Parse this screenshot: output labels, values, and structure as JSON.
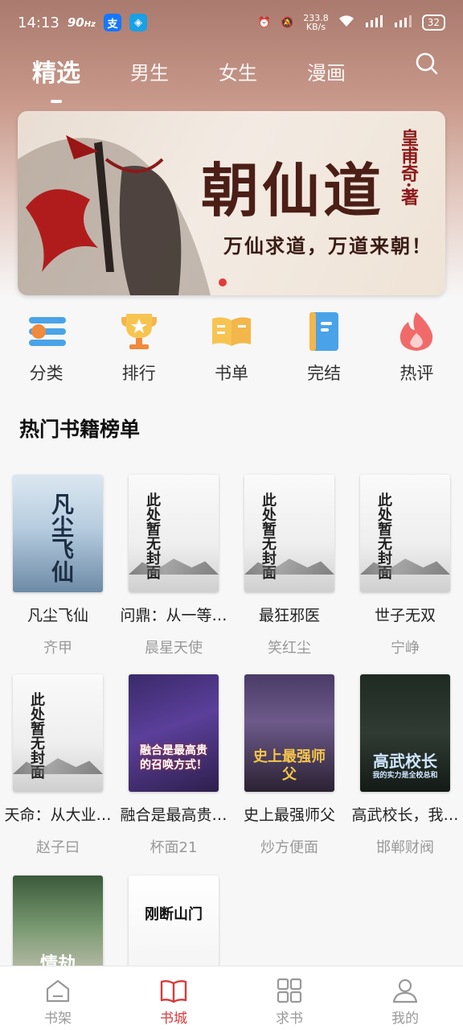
{
  "status": {
    "time": "14:13",
    "hz": "90",
    "hz_unit": "Hz",
    "speed": "233.8",
    "speed_unit": "KB/s",
    "battery": "32"
  },
  "nav": {
    "tabs": [
      {
        "label": "精选",
        "active": true
      },
      {
        "label": "男生",
        "active": false
      },
      {
        "label": "女生",
        "active": false
      },
      {
        "label": "漫画",
        "active": false
      }
    ]
  },
  "banner": {
    "title": "朝仙道",
    "author": "皇甫奇·著",
    "slogan": "万仙求道，万道来朝！"
  },
  "quick_nav": [
    {
      "label": "分类",
      "icon": "category-icon"
    },
    {
      "label": "排行",
      "icon": "trophy-icon"
    },
    {
      "label": "书单",
      "icon": "book-open-icon"
    },
    {
      "label": "完结",
      "icon": "notebook-icon"
    },
    {
      "label": "热评",
      "icon": "flame-icon"
    }
  ],
  "section_title": "热门书籍榜单",
  "books": [
    {
      "title": "凡尘飞仙",
      "author": "齐甲",
      "cover": "fanchen",
      "cover_text": "凡尘飞仙"
    },
    {
      "title": "问鼎：从一等…",
      "author": "晨星天使",
      "cover": "default"
    },
    {
      "title": "最狂邪医",
      "author": "笑红尘",
      "cover": "default"
    },
    {
      "title": "世子无双",
      "author": "宁峥",
      "cover": "default"
    },
    {
      "title": "天命：从大业…",
      "author": "赵子曰",
      "cover": "default"
    },
    {
      "title": "融合是最高贵…",
      "author": "杯面21",
      "cover": "ronghe",
      "cover_text": "融合是最高贵的召唤方式！"
    },
    {
      "title": "史上最强师父",
      "author": "炒方便面",
      "cover": "shifu",
      "cover_text": "史上最强师父"
    },
    {
      "title": "高武校长，我…",
      "author": "邯郸财阀",
      "cover": "gaowu",
      "cover_text": "高武校长",
      "cover_sub": "我的实力是全校总和"
    },
    {
      "title": "",
      "author": "",
      "cover": "qingjie",
      "cover_text": "情劫"
    },
    {
      "title": "",
      "author": "",
      "cover": "xiaomen",
      "cover_text": "刚断山门"
    }
  ],
  "default_cover_text": "此处暂无封面",
  "tabbar": [
    {
      "label": "书架",
      "icon": "bookshelf-icon",
      "active": false
    },
    {
      "label": "书城",
      "icon": "bookstore-icon",
      "active": true
    },
    {
      "label": "求书",
      "icon": "grid-icon",
      "active": false
    },
    {
      "label": "我的",
      "icon": "profile-icon",
      "active": false
    }
  ],
  "colors": {
    "accent": "#d93a3a",
    "header_top": "#a97a6d",
    "muted_text": "#999999"
  }
}
